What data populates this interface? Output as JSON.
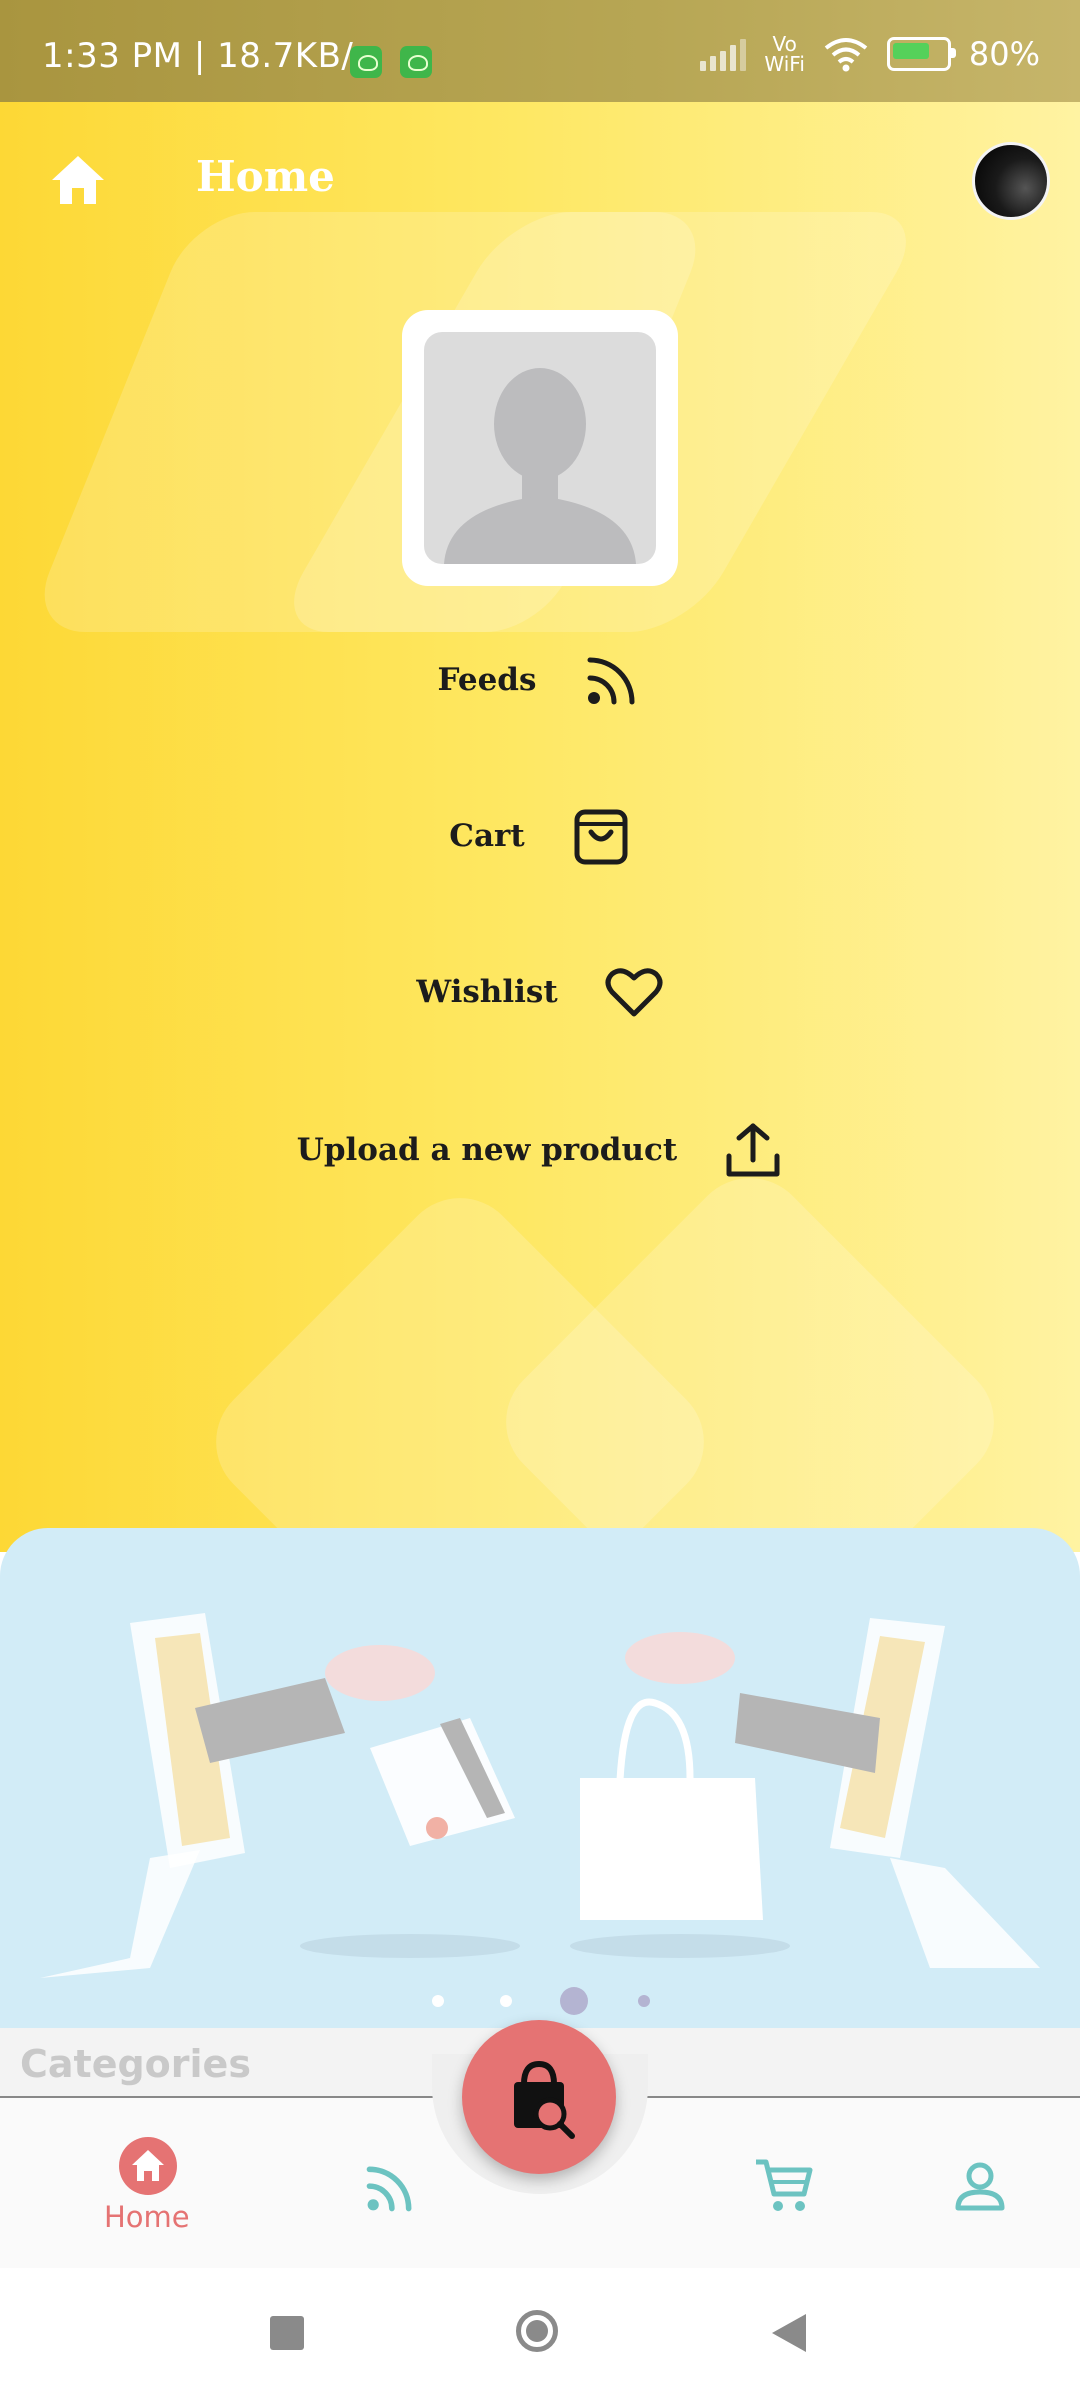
{
  "status_bar": {
    "time": "1:33 PM",
    "separator": "|",
    "speed": "18.7KB/s",
    "vowifi_top": "Vo",
    "vowifi_bottom": "WiFi",
    "battery": "80%"
  },
  "app_bar": {
    "title": "Home",
    "icon": "home-icon"
  },
  "menu": [
    {
      "label": "Feeds",
      "icon": "rss-icon"
    },
    {
      "label": "Cart",
      "icon": "shopping-bag-icon"
    },
    {
      "label": "Wishlist",
      "icon": "heart-icon"
    },
    {
      "label": "Upload a new product",
      "icon": "upload-icon"
    }
  ],
  "carousel": {
    "slide_count": 4,
    "active_index": 2
  },
  "categories": {
    "title": "Categories"
  },
  "bottom_nav": {
    "items": [
      {
        "label": "Home",
        "icon": "home-icon",
        "active": true
      },
      {
        "label": "",
        "icon": "rss-icon"
      },
      {
        "label": "",
        "icon": "cart-icon"
      },
      {
        "label": "",
        "icon": "person-icon"
      }
    ],
    "fab_icon": "shopping-bag-search-icon"
  },
  "colors": {
    "yellow_start": "#fdd835",
    "yellow_end": "#fff3a2",
    "accent_red": "#e57373",
    "teal": "#6cc3c1",
    "banner_blue": "#d2ecf7"
  }
}
